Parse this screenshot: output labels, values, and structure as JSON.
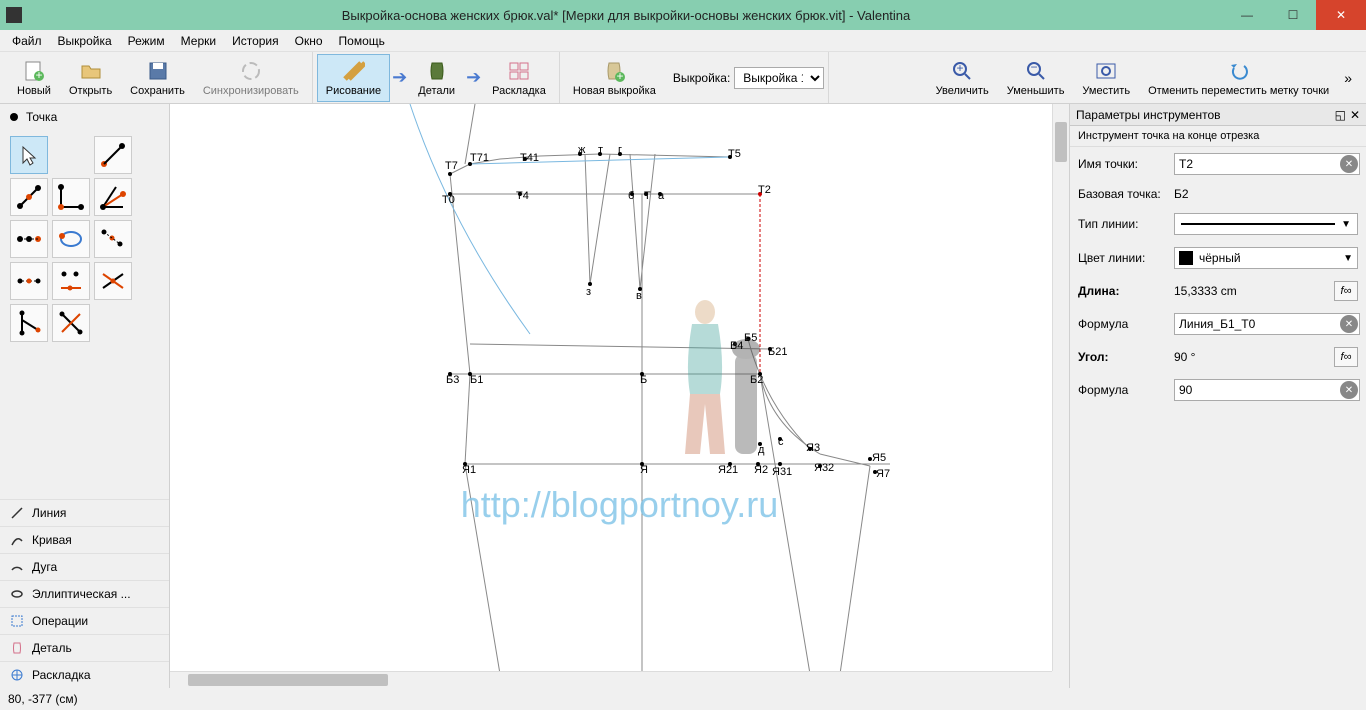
{
  "titlebar": {
    "title": "Выкройка-основа женских брюк.val* [Мерки для выкройки-основы женских брюк.vit] - Valentina"
  },
  "menubar": [
    "Файл",
    "Выкройка",
    "Режим",
    "Мерки",
    "История",
    "Окно",
    "Помощь"
  ],
  "toolbar": {
    "new": "Новый",
    "open": "Открыть",
    "save": "Сохранить",
    "sync": "Синхронизировать",
    "draw": "Рисование",
    "detail": "Детали",
    "layout": "Раскладка",
    "newpattern": "Новая выкройка",
    "pattern_label": "Выкройка:",
    "pattern_value": "Выкройка 1",
    "zoomin": "Увеличить",
    "zoomout": "Уменьшить",
    "fit": "Уместить",
    "undomove": "Отменить переместить метку точки"
  },
  "left": {
    "header": "Точка",
    "categories": [
      "Линия",
      "Кривая",
      "Дуга",
      "Эллиптическая ...",
      "Операции",
      "Деталь",
      "Раскладка"
    ]
  },
  "canvas": {
    "watermark": "http://blogportnoy.ru",
    "points": {
      "T7": "Т7",
      "T71": "Т71",
      "T41": "Т41",
      "zh": "ж",
      "tt": "т",
      "gg": "г",
      "T5": "Т5",
      "T0": "Т0",
      "T4": "Т4",
      "bb": "б",
      "TT": "Т",
      "aa": "а",
      "T2": "Т2",
      "zz": "з",
      "vv": "в",
      "B3": "Б3",
      "B1": "Б1",
      "BB": "Б",
      "B4": "Б4",
      "B5": "Б5",
      "B2": "Б2",
      "B21": "Б21",
      "dd": "д",
      "cc": "с",
      "Ya1": "Я1",
      "Ya": "Я",
      "Ya21": "Я21",
      "Ya2": "Я2",
      "Ya31": "Я31",
      "Ya3": "Я3",
      "Ya32": "Я32",
      "Ya5": "Я5",
      "Ya7": "Я7"
    }
  },
  "right": {
    "panel_title": "Параметры инструментов",
    "subheader": "Инструмент точка на конце отрезка",
    "name_label": "Имя точки:",
    "name_value": "Т2",
    "base_label": "Базовая точка:",
    "base_value": "Б2",
    "linetype_label": "Тип линии:",
    "linecolor_label": "Цвет линии:",
    "linecolor_value": "чёрный",
    "length_label": "Длина:",
    "length_value": "15,3333 cm",
    "formula1_label": "Формула",
    "formula1_value": "Линия_Б1_Т0",
    "angle_label": "Угол:",
    "angle_value": "90 °",
    "formula2_label": "Формула",
    "formula2_value": "90"
  },
  "statusbar": {
    "coords": "80, -377 (см)"
  }
}
